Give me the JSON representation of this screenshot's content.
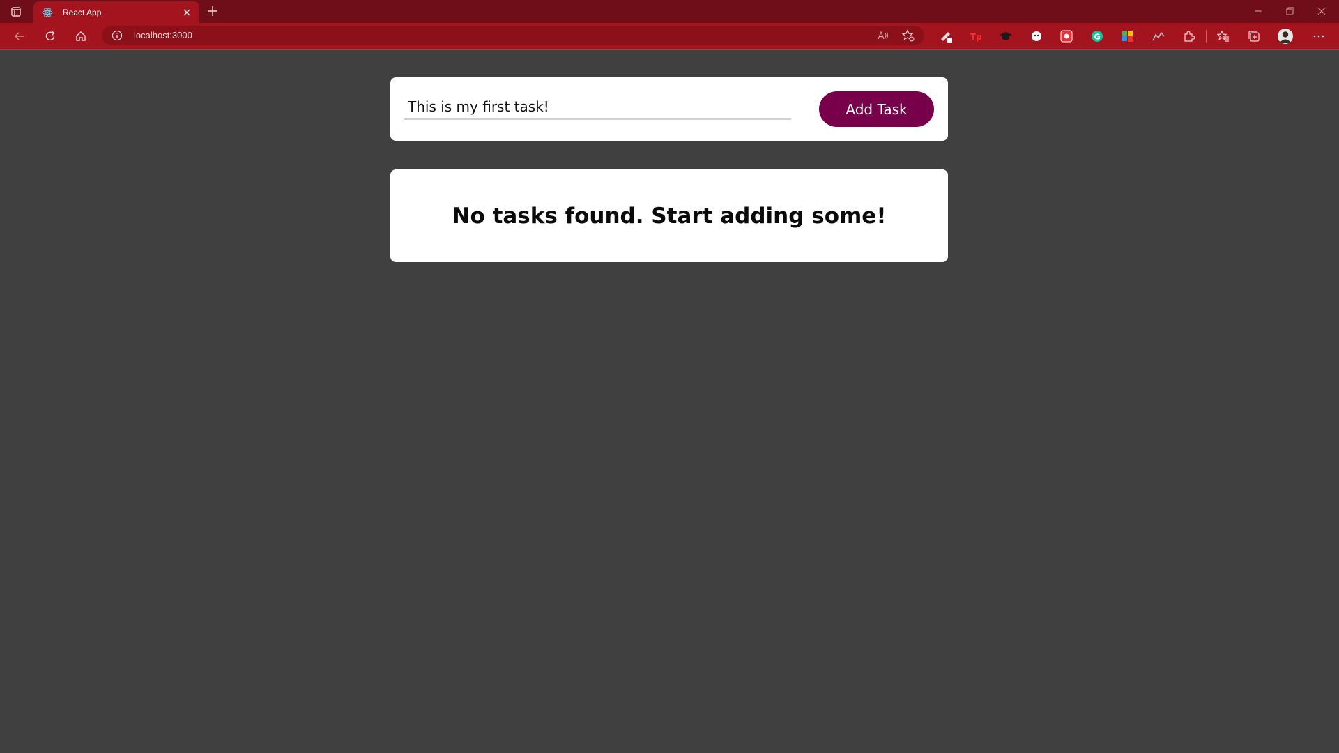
{
  "browser": {
    "tab": {
      "title": "React App",
      "favicon": "react-icon"
    },
    "address": {
      "url": "localhost:3000"
    },
    "colors": {
      "titlebar": "#6f0e18",
      "toolbar": "#a3141f"
    }
  },
  "app": {
    "input": {
      "value": "This is my first task!"
    },
    "add_button_label": "Add Task",
    "empty_message": "No tasks found. Start adding some!",
    "colors": {
      "background": "#404040",
      "accent": "#78004a"
    }
  }
}
